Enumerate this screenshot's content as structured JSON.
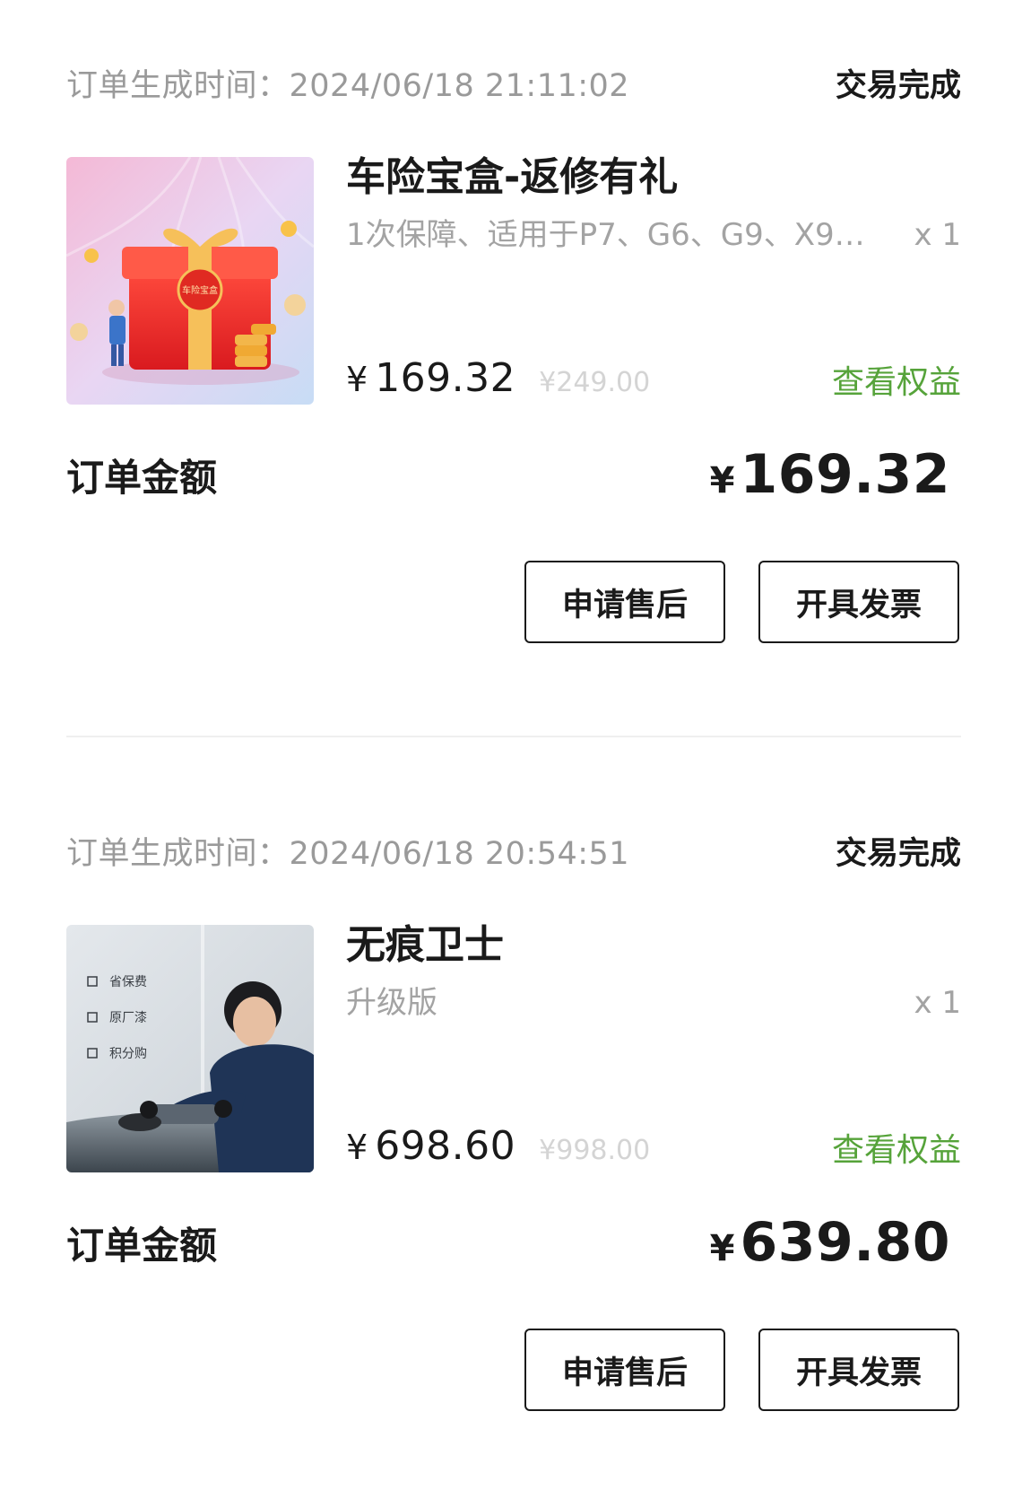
{
  "orders": [
    {
      "time_label": "订单生成时间：",
      "time_value": "2024/06/18 21:11:02",
      "status": "交易完成",
      "product": {
        "title": "车险宝盒-返修有礼",
        "spec": "1次保障、适用于P7、G6、G9、X9…",
        "qty": "x 1",
        "currency": "¥",
        "price": "169.32",
        "original_price": "¥249.00",
        "image_text": "车险宝盒"
      },
      "benefit_link": "查看权益",
      "total_label": "订单金额",
      "total_currency": "¥",
      "total_amount": "169.32",
      "actions": {
        "after_sale": "申请售后",
        "invoice": "开具发票"
      }
    },
    {
      "time_label": "订单生成时间：",
      "time_value": "2024/06/18 20:54:51",
      "status": "交易完成",
      "product": {
        "title": "无痕卫士",
        "spec": "升级版",
        "qty": "x 1",
        "currency": "¥",
        "price": "698.60",
        "original_price": "¥998.00",
        "image_features": [
          "省保费",
          "原厂漆",
          "积分购"
        ]
      },
      "benefit_link": "查看权益",
      "total_label": "订单金额",
      "total_currency": "¥",
      "total_amount": "639.80",
      "actions": {
        "after_sale": "申请售后",
        "invoice": "开具发票"
      }
    }
  ],
  "colors": {
    "benefit_green": "#56a33a",
    "muted_gray": "#9a9a9a",
    "strike_gray": "#d4d4d4",
    "text_dark": "#1a1a1a"
  }
}
